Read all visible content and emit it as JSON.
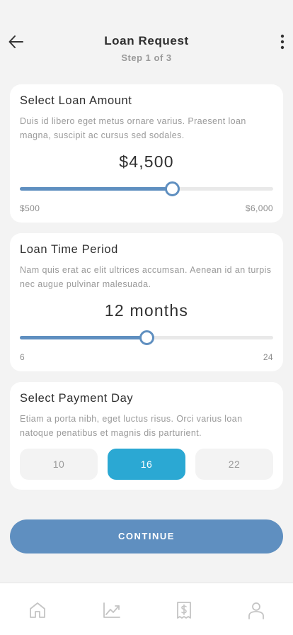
{
  "header": {
    "title": "Loan Request",
    "step": "Step 1 of 3"
  },
  "loan_amount": {
    "title": "Select Loan Amount",
    "description": "Duis id libero eget metus ornare varius. Praesent loan magna, suscipit ac cursus sed sodales.",
    "value": "$4,500",
    "min_label": "$500",
    "max_label": "$6,000",
    "slider_fraction": 0.6
  },
  "time_period": {
    "title": "Loan Time Period",
    "description": "Nam quis erat ac elit ultrices accumsan. Aenean id an turpis nec augue pulvinar malesuada.",
    "value": "12 months",
    "min_label": "6",
    "max_label": "24",
    "slider_fraction": 0.5
  },
  "payment_day": {
    "title": "Select Payment Day",
    "description": "Etiam a porta nibh, eget luctus risus. Orci varius loan natoque penatibus et magnis dis parturient.",
    "options": [
      "10",
      "16",
      "22"
    ],
    "selected": "16"
  },
  "continue_label": "CONTINUE",
  "nav": {
    "items": [
      "home-icon",
      "chart-icon",
      "receipt-icon",
      "profile-icon"
    ]
  },
  "colors": {
    "accent": "#5f8fc0",
    "selected": "#2ba8d3",
    "background": "#f3f3f3"
  }
}
